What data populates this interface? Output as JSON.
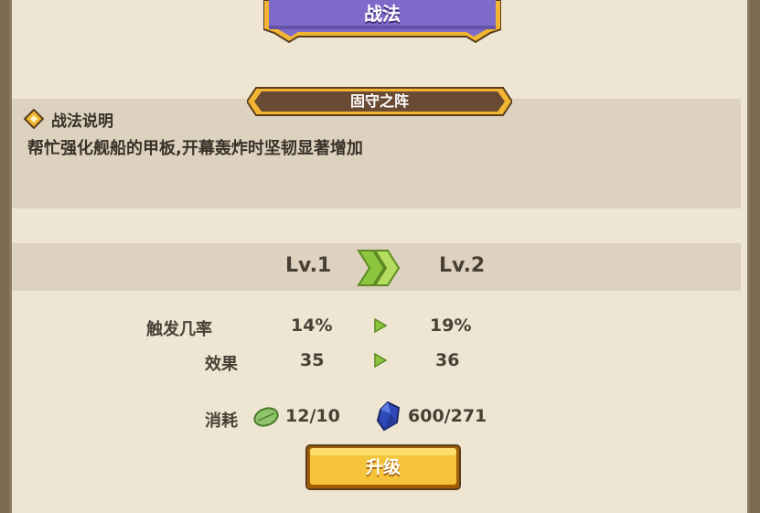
{
  "header": {
    "title": "战法"
  },
  "tactic": {
    "name": "固守之阵",
    "section_title": "战法说明",
    "description": "帮忙强化舰船的甲板,开幕轰炸时坚韧显著增加"
  },
  "level": {
    "from": "Lv.1",
    "to": "Lv.2"
  },
  "stats": [
    {
      "label": "触发几率",
      "from": "14%",
      "to": "19%"
    },
    {
      "label": "效果",
      "from": "35",
      "to": "36"
    }
  ],
  "cost": {
    "label": "消耗",
    "items": [
      {
        "icon": "leaf-icon",
        "value": "12/10"
      },
      {
        "icon": "blue-gem-icon",
        "value": "600/271"
      }
    ]
  },
  "actions": {
    "upgrade_label": "升级"
  },
  "colors": {
    "panel_bg": "#efe5d3",
    "banner_purple": "#7e6ac8",
    "banner_gold": "#f2b531",
    "subtitle_brown": "#6b4a34",
    "button_yellow": "#f6c43a",
    "arrow_green": "#8cc63f"
  }
}
